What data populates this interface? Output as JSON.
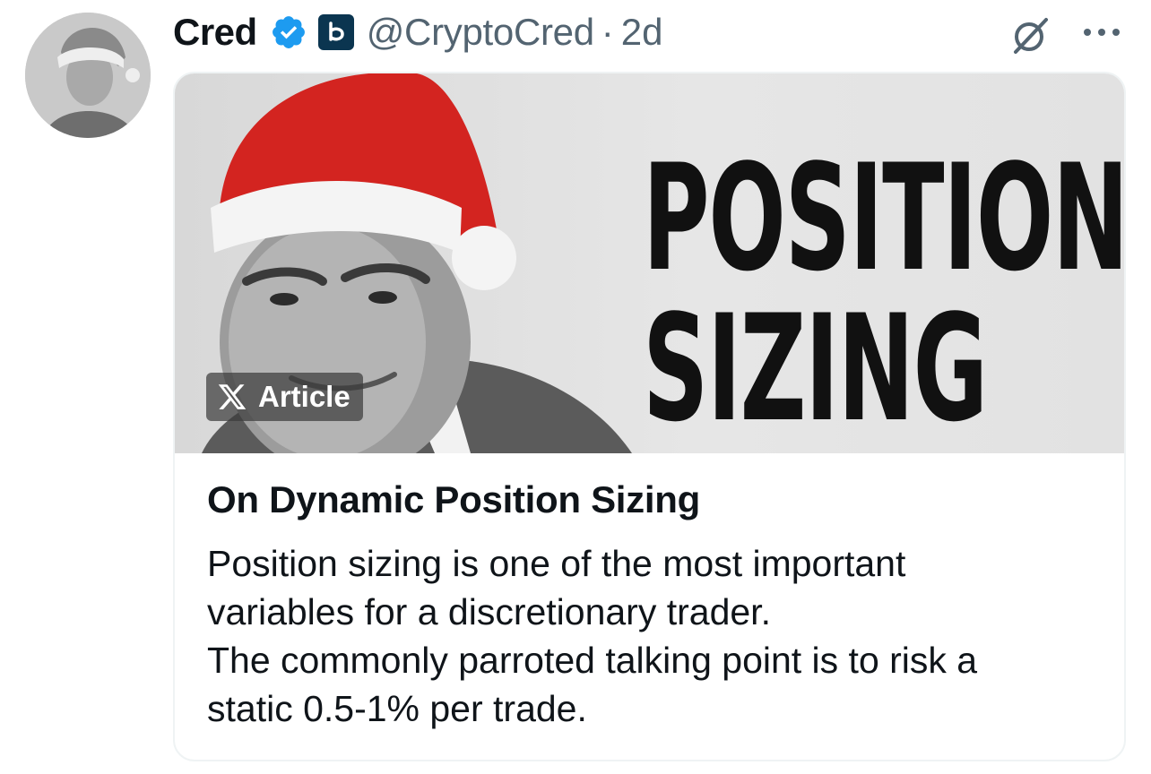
{
  "author": {
    "name": "Cred",
    "handle": "@CryptoCred",
    "separator": "·",
    "time": "2d",
    "verified_color": "#1d9bf0",
    "affiliate_badge_color": "#0b3550"
  },
  "icons": {
    "grok": "grok-icon",
    "more": "more-icon",
    "verified": "verified-badge-icon",
    "affiliate": "affiliate-badge-icon"
  },
  "card": {
    "cover_lines": [
      "POSITION",
      "SIZING"
    ],
    "badge_label": "Article",
    "title": "On Dynamic Position Sizing",
    "body_lines": [
      "Position sizing is one of the most important",
      "variables for a discretionary trader.",
      "The commonly parroted talking point is to risk a",
      "static 0.5-1% per trade."
    ]
  }
}
